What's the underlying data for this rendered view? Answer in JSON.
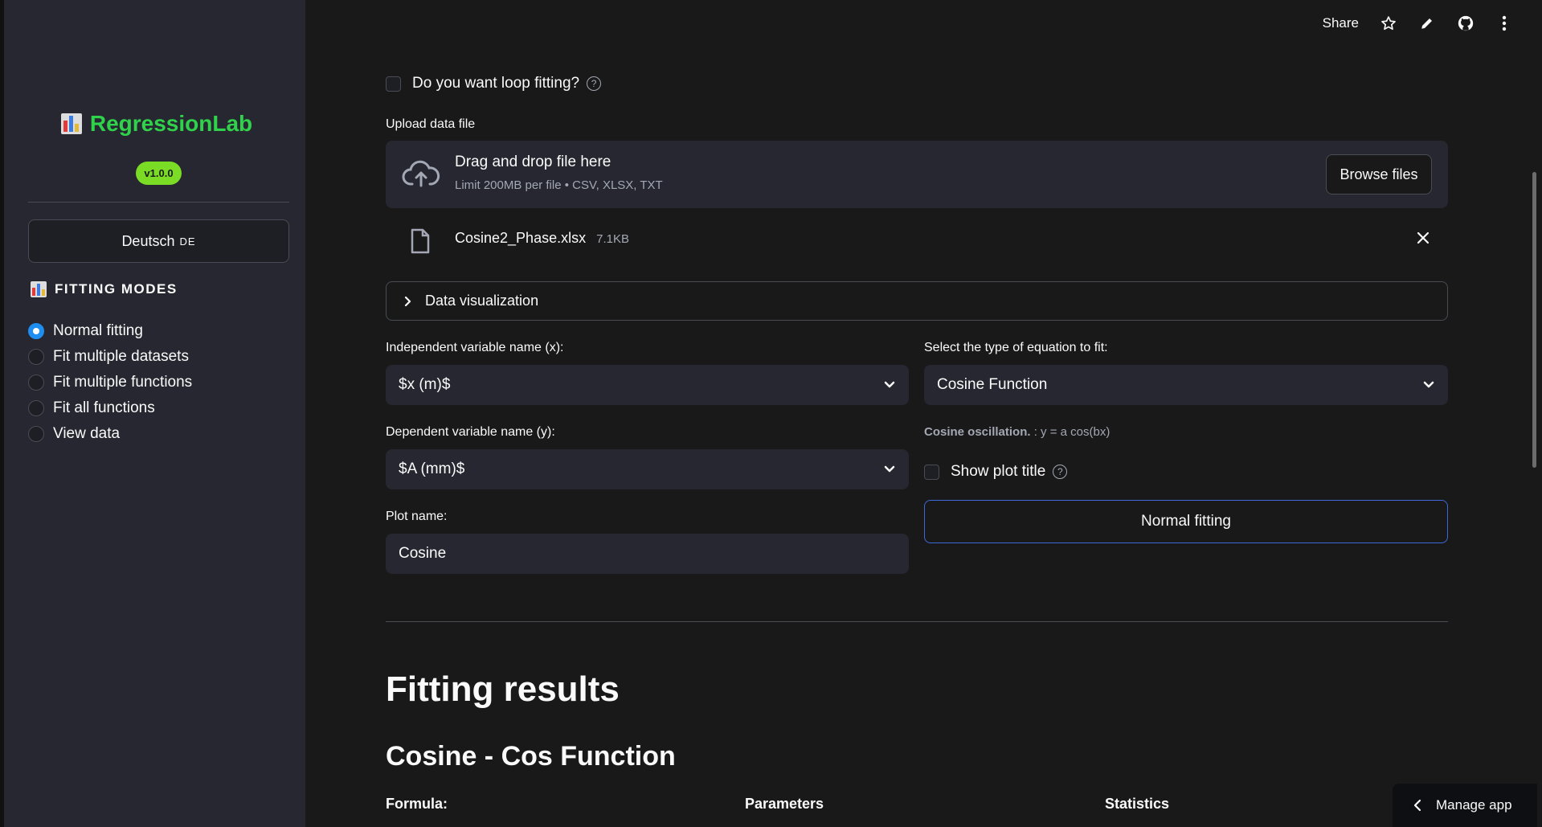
{
  "sidebar": {
    "brand": "RegressionLab",
    "version": "v1.0.0",
    "language_button": "Deutsch",
    "language_code": "DE",
    "modes_title": "FITTING MODES",
    "modes": [
      {
        "label": "Normal fitting",
        "selected": true
      },
      {
        "label": "Fit multiple datasets",
        "selected": false
      },
      {
        "label": "Fit multiple functions",
        "selected": false
      },
      {
        "label": "Fit all functions",
        "selected": false
      },
      {
        "label": "View data",
        "selected": false
      }
    ]
  },
  "topbar": {
    "share_label": "Share"
  },
  "main": {
    "loop_fitting_label": "Do you want loop fitting?",
    "upload_label": "Upload data file",
    "dropzone_title": "Drag and drop file here",
    "dropzone_sub": "Limit 200MB per file • CSV, XLSX, TXT",
    "browse_label": "Browse files",
    "file_name": "Cosine2_Phase.xlsx",
    "file_size": "7.1KB",
    "expander_label": "Data visualization",
    "x_label": "Independent variable name (x):",
    "x_value": "$x (m)$",
    "y_label": "Dependent variable name (y):",
    "y_value": "$A (mm)$",
    "plot_name_label": "Plot name:",
    "plot_name_value": "Cosine",
    "equation_label": "Select the type of equation to fit:",
    "equation_value": "Cosine Function",
    "equation_caption_bold": "Cosine oscillation.",
    "equation_caption_rest": " : y = a cos(bx)",
    "show_title_label": "Show plot title",
    "fit_button": "Normal fitting",
    "results_title": "Fitting results",
    "result_subtitle": "Cosine - Cos Function",
    "col_formula": "Formula:",
    "col_parameters": "Parameters",
    "col_statistics": "Statistics",
    "manage_app": "Manage app"
  },
  "colors": {
    "accent": "#1f8ef1",
    "brand": "#2fd24a",
    "version_badge": "#7bdc26"
  }
}
